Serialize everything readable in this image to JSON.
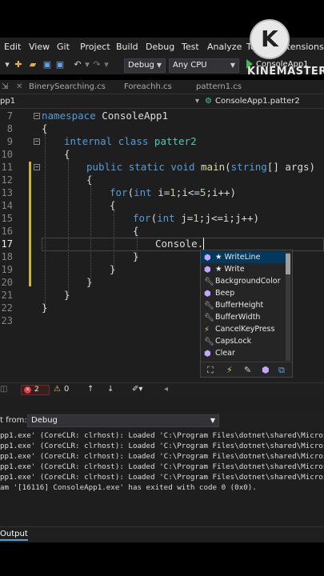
{
  "menu": [
    "Edit",
    "View",
    "Git",
    "Project",
    "Build",
    "Debug",
    "Test",
    "Analyze",
    "Tools",
    "Extensions"
  ],
  "toolbar": {
    "config": "Debug",
    "platform": "Any CPU",
    "run_target": "ConsoleApp1"
  },
  "watermark": {
    "letter": "K",
    "text": "KINEMASTER"
  },
  "tabs": [
    {
      "label": "BinerySearching.cs"
    },
    {
      "label": "Foreachh.cs"
    },
    {
      "label": "pattern1.cs"
    }
  ],
  "nav": {
    "project": "pp1",
    "member": "ConsoleApp1.patter2"
  },
  "editor": {
    "line_numbers": [
      "7",
      "8",
      "9",
      "10",
      "11",
      "12",
      "13",
      "14",
      "15",
      "16",
      "17",
      "18",
      "19",
      "20",
      "21",
      "22",
      "23"
    ],
    "lines": {
      "l7": {
        "kw": "namespace",
        "rest": " ConsoleApp1"
      },
      "l8": {
        "text": "{"
      },
      "l9": {
        "kw1": "internal",
        "kw2": "class",
        "cls": "patter2"
      },
      "l10": {
        "text": "{"
      },
      "l11": {
        "kw1": "public",
        "kw2": "static",
        "kw3": "void",
        "fn": "main",
        "p1": "(",
        "kw4": "string",
        "p2": "[] args)"
      },
      "l12": {
        "text": "{"
      },
      "l13": {
        "kw": "for",
        "a": "(",
        "kw2": "int",
        "b": " i=",
        "n1": "1",
        "c": ";i<=",
        "n2": "5",
        "d": ";i++)"
      },
      "l14": {
        "text": "{"
      },
      "l15": {
        "kw": "for",
        "a": "(",
        "kw2": "int",
        "b": " j=",
        "n1": "1",
        "c": ";j<=i;j++)"
      },
      "l16": {
        "text": "{"
      },
      "l17": {
        "text": "Console."
      },
      "l18": {
        "text": "}"
      },
      "l19": {
        "text": "}"
      },
      "l20": {
        "text": "}"
      },
      "l21": {
        "text": "}"
      },
      "l22": {
        "text": "}"
      }
    }
  },
  "intellisense": {
    "items": [
      {
        "label": "★ WriteLine",
        "icon": "method-cube-icon"
      },
      {
        "label": "★ Write",
        "icon": "method-cube-icon"
      },
      {
        "label": "BackgroundColor",
        "icon": "property-wrench-icon"
      },
      {
        "label": "Beep",
        "icon": "method-cube-icon"
      },
      {
        "label": "BufferHeight",
        "icon": "property-wrench-icon"
      },
      {
        "label": "BufferWidth",
        "icon": "property-wrench-icon"
      },
      {
        "label": "CancelKeyPress",
        "icon": "event-bolt-icon"
      },
      {
        "label": "CapsLock",
        "icon": "property-wrench-icon"
      },
      {
        "label": "Clear",
        "icon": "method-cube-icon"
      }
    ]
  },
  "status": {
    "errors": "2",
    "warnings": "0"
  },
  "output": {
    "show_from_label": "t from:",
    "source": "Debug",
    "lines": [
      "pp1.exe' (CoreCLR: clrhost): Loaded 'C:\\Program Files\\dotnet\\shared\\Microsoft.N",
      "pp1.exe' (CoreCLR: clrhost): Loaded 'C:\\Program Files\\dotnet\\shared\\Microsoft.N",
      "pp1.exe' (CoreCLR: clrhost): Loaded 'C:\\Program Files\\dotnet\\shared\\Microsoft.N",
      "pp1.exe' (CoreCLR: clrhost): Loaded 'C:\\Program Files\\dotnet\\shared\\Microsoft.N",
      "pp1.exe' (CoreCLR: clrhost): Loaded 'C:\\Program Files\\dotnet\\shared\\Microsoft.N",
      "am '[16116] ConsoleApp1.exe' has exited with code 0 (0x0)."
    ]
  },
  "bottom_tab": "Output",
  "colors": {
    "keyword": "#569cd6",
    "method": "#dcdcaa",
    "type": "#4ec9b0",
    "number": "#b5cea8",
    "selection": "#04395e"
  }
}
